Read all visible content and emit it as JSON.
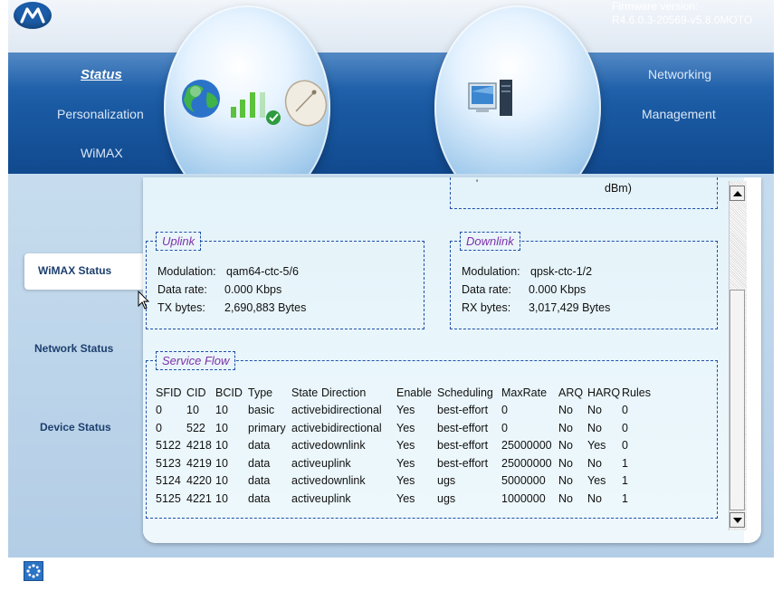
{
  "header": {
    "logo_icon": "motorola-logo-icon",
    "firmware_label": "Firmware version:",
    "firmware_value": "R4.6.0.3-20569-v5.8.0MOTO",
    "nav_left": [
      "Status",
      "Personalization",
      "WiMAX"
    ],
    "nav_right": [
      "Networking",
      "Management"
    ],
    "active_nav": "Status"
  },
  "sidebar": {
    "tabs": [
      "WiMAX Status",
      "Network Status",
      "Device Status"
    ],
    "active": "WiMAX Status"
  },
  "top_box": {
    "partial_text": "dBm)"
  },
  "uplink": {
    "title": "Uplink",
    "modulation_label": "Modulation:",
    "modulation_value": "qam64-ctc-5/6",
    "rate_label": "Data rate:",
    "rate_value": "0.000 Kbps",
    "bytes_label": "TX bytes:",
    "bytes_value": "2,690,883 Bytes"
  },
  "downlink": {
    "title": "Downlink",
    "modulation_label": "Modulation:",
    "modulation_value": "qpsk-ctc-1/2",
    "rate_label": "Data rate:",
    "rate_value": "0.000 Kbps",
    "bytes_label": "RX bytes:",
    "bytes_value": "3,017,429 Bytes"
  },
  "service_flow": {
    "title": "Service Flow",
    "columns": [
      "SFID",
      "CID",
      "BCID",
      "Type",
      "State",
      "Direction",
      "Enable",
      "Scheduling",
      "MaxRate",
      "ARQ",
      "HARQ",
      "Rules"
    ],
    "rows": [
      [
        "0",
        "10",
        "10",
        "basic",
        "active",
        "bidirectional",
        "Yes",
        "best-effort",
        "0",
        "No",
        "No",
        "0"
      ],
      [
        "0",
        "522",
        "10",
        "primary",
        "active",
        "bidirectional",
        "Yes",
        "best-effort",
        "0",
        "No",
        "No",
        "0"
      ],
      [
        "5122",
        "4218",
        "10",
        "data",
        "active",
        "downlink",
        "Yes",
        "best-effort",
        "25000000",
        "No",
        "Yes",
        "0"
      ],
      [
        "5123",
        "4219",
        "10",
        "data",
        "active",
        "uplink",
        "Yes",
        "best-effort",
        "25000000",
        "No",
        "No",
        "1"
      ],
      [
        "5124",
        "4220",
        "10",
        "data",
        "active",
        "downlink",
        "Yes",
        "ugs",
        "5000000",
        "No",
        "Yes",
        "1"
      ],
      [
        "5125",
        "4221",
        "10",
        "data",
        "active",
        "uplink",
        "Yes",
        "ugs",
        "1000000",
        "No",
        "No",
        "1"
      ]
    ]
  },
  "colors": {
    "header_blue": "#1c5aa3",
    "panel_bg": "#eaf5fb",
    "legend_text": "#7b32a8",
    "dash_border": "#1e4fa8"
  }
}
